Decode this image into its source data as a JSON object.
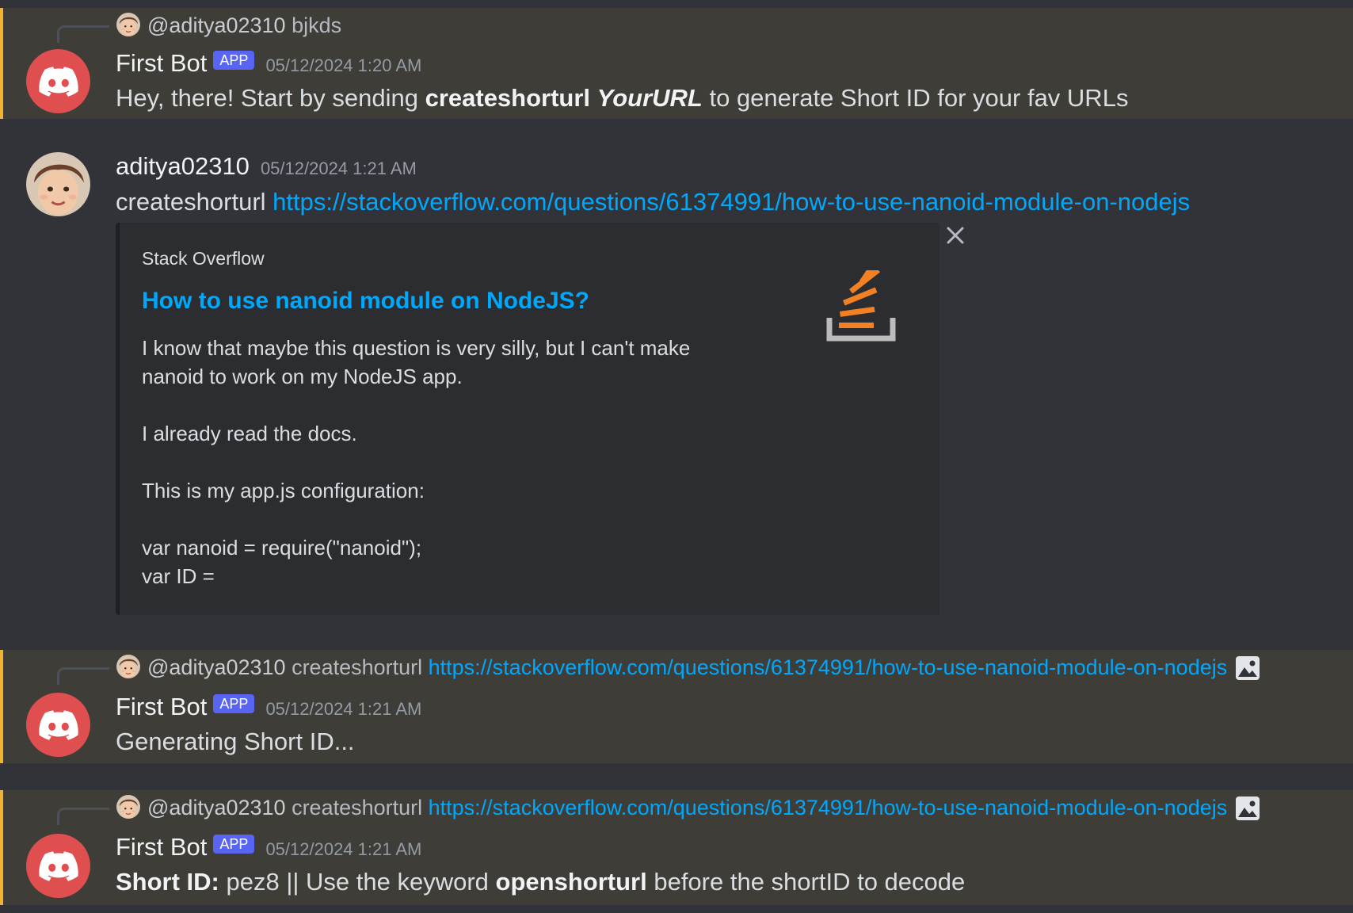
{
  "colors": {
    "background": "#313338",
    "mention_background": "#3f3d37",
    "mention_bar": "#f0b232",
    "link": "#00a8fc",
    "app_badge": "#5865f2",
    "bot_avatar": "#e04f4f"
  },
  "messages": [
    {
      "reply": {
        "handle": "@aditya02310",
        "text": "bjkds"
      },
      "author": "First Bot",
      "badge": "APP",
      "timestamp": "05/12/2024 1:20 AM",
      "body": {
        "pre": "Hey, there! Start by sending ",
        "bold": "createshorturl",
        "bold_italic": "YourURL",
        "post": " to generate Short ID for your fav URLs"
      }
    },
    {
      "author": "aditya02310",
      "timestamp": "05/12/2024 1:21 AM",
      "body": {
        "pre": "createshorturl ",
        "link": "https://stackoverflow.com/questions/61374991/how-to-use-nanoid-module-on-nodejs"
      },
      "embed": {
        "provider": "Stack Overflow",
        "title": "How to use nanoid module on NodeJS?",
        "description": "I know that maybe this question is very silly, but I can't make\nnanoid to work on my NodeJS app.\n\nI already read the docs.\n\nThis is my app.js configuration:\n\nvar nanoid = require(\"nanoid\");\nvar ID =",
        "thumbnail_icon": "stackoverflow-logo-icon",
        "close_icon": "close-icon"
      }
    },
    {
      "reply": {
        "handle": "@aditya02310",
        "text": "createshorturl ",
        "link": "https://stackoverflow.com/questions/61374991/how-to-use-nanoid-module-on-nodejs",
        "attachment_icon": "image-icon"
      },
      "author": "First Bot",
      "badge": "APP",
      "timestamp": "05/12/2024 1:21 AM",
      "body": {
        "text": "Generating Short ID..."
      }
    },
    {
      "reply": {
        "handle": "@aditya02310",
        "text": "createshorturl ",
        "link": "https://stackoverflow.com/questions/61374991/how-to-use-nanoid-module-on-nodejs",
        "attachment_icon": "image-icon"
      },
      "author": "First Bot",
      "badge": "APP",
      "timestamp": "05/12/2024 1:21 AM",
      "body": {
        "bold1": "Short ID:",
        "mid": " pez8 || Use the keyword ",
        "bold2": "openshorturl",
        "post": " before the shortID to decode"
      }
    }
  ]
}
